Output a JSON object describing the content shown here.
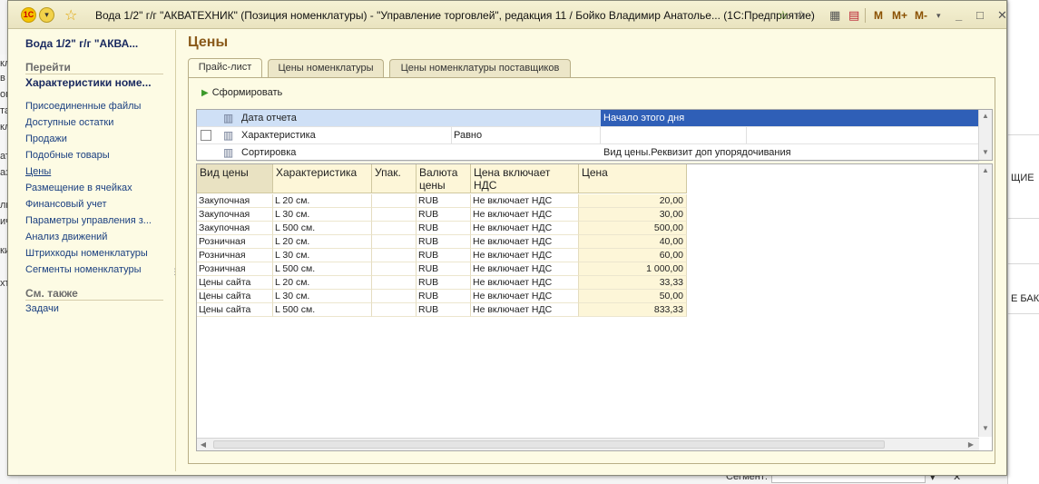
{
  "window": {
    "title": "Вода  1/2\" г/г \"АКВАТЕХНИК\" (Позиция номенклатуры) - \"Управление торговлей\", редакция 11 / Бойко Владимир Анатолье...  (1С:Предприятие)",
    "logo_text": "1С",
    "toolbar": {
      "m": "M",
      "m_plus": "M+",
      "m_minus": "M-"
    }
  },
  "background": {
    "left_fragments": [
      "кл",
      "в",
      "огд",
      "там",
      "кл",
      "ат",
      "аз",
      "ли",
      "ичет",
      "ки",
      "хт"
    ],
    "right_fragments": [
      "ЩИЕ",
      "Е БАК"
    ],
    "bottom_label": "Сегмент:"
  },
  "nav": {
    "header": "Вода  1/2\" г/г \"АКВА...",
    "goto_title": "Перейти",
    "active_item": "Характеристики номе...",
    "items": [
      "Присоединенные файлы",
      "Доступные остатки",
      "Продажи",
      "Подобные товары",
      "Цены",
      "Размещение в ячейках",
      "Финансовый учет",
      "Параметры управления з...",
      "Анализ движений",
      "Штрихкоды номенклатуры",
      "Сегменты номенклатуры"
    ],
    "see_also_title": "См. также",
    "see_also_items": [
      "Задачи"
    ]
  },
  "page": {
    "title": "Цены",
    "tabs": [
      "Прайс-лист",
      "Цены номенклатуры",
      "Цены номенклатуры поставщиков"
    ],
    "form_button": "Сформировать"
  },
  "settings": [
    {
      "name": "Дата отчета",
      "condition": "",
      "value": "Начало этого дня"
    },
    {
      "name": "Характеристика",
      "condition": "Равно",
      "value": ""
    },
    {
      "name": "Сортировка",
      "condition": "",
      "value": "Вид цены.Реквизит доп упорядочивания"
    }
  ],
  "price_table": {
    "columns": [
      "Вид цены",
      "Характеристика",
      "Упак.",
      "Валюта цены",
      "Цена включает НДС",
      "Цена"
    ],
    "rows": [
      [
        "Закупочная",
        "L  20 см.",
        "",
        "RUB",
        "Не включает НДС",
        "20,00"
      ],
      [
        "Закупочная",
        "L  30 см.",
        "",
        "RUB",
        "Не включает НДС",
        "30,00"
      ],
      [
        "Закупочная",
        "L 500 см.",
        "",
        "RUB",
        "Не включает НДС",
        "500,00"
      ],
      [
        "Розничная",
        "L  20 см.",
        "",
        "RUB",
        "Не включает НДС",
        "40,00"
      ],
      [
        "Розничная",
        "L  30 см.",
        "",
        "RUB",
        "Не включает НДС",
        "60,00"
      ],
      [
        "Розничная",
        "L 500 см.",
        "",
        "RUB",
        "Не включает НДС",
        "1 000,00"
      ],
      [
        "Цены сайта",
        "L  20 см.",
        "",
        "RUB",
        "Не включает НДС",
        "33,33"
      ],
      [
        "Цены сайта",
        "L  30 см.",
        "",
        "RUB",
        "Не включает НДС",
        "50,00"
      ],
      [
        "Цены сайта",
        "L 500 см.",
        "",
        "RUB",
        "Не включает НДС",
        "833,33"
      ]
    ]
  },
  "colors": {
    "window_bg": "#fdfbe4",
    "selection": "#2f5fb7",
    "title_accent": "#8a5a1a",
    "link": "#1a3f80"
  }
}
